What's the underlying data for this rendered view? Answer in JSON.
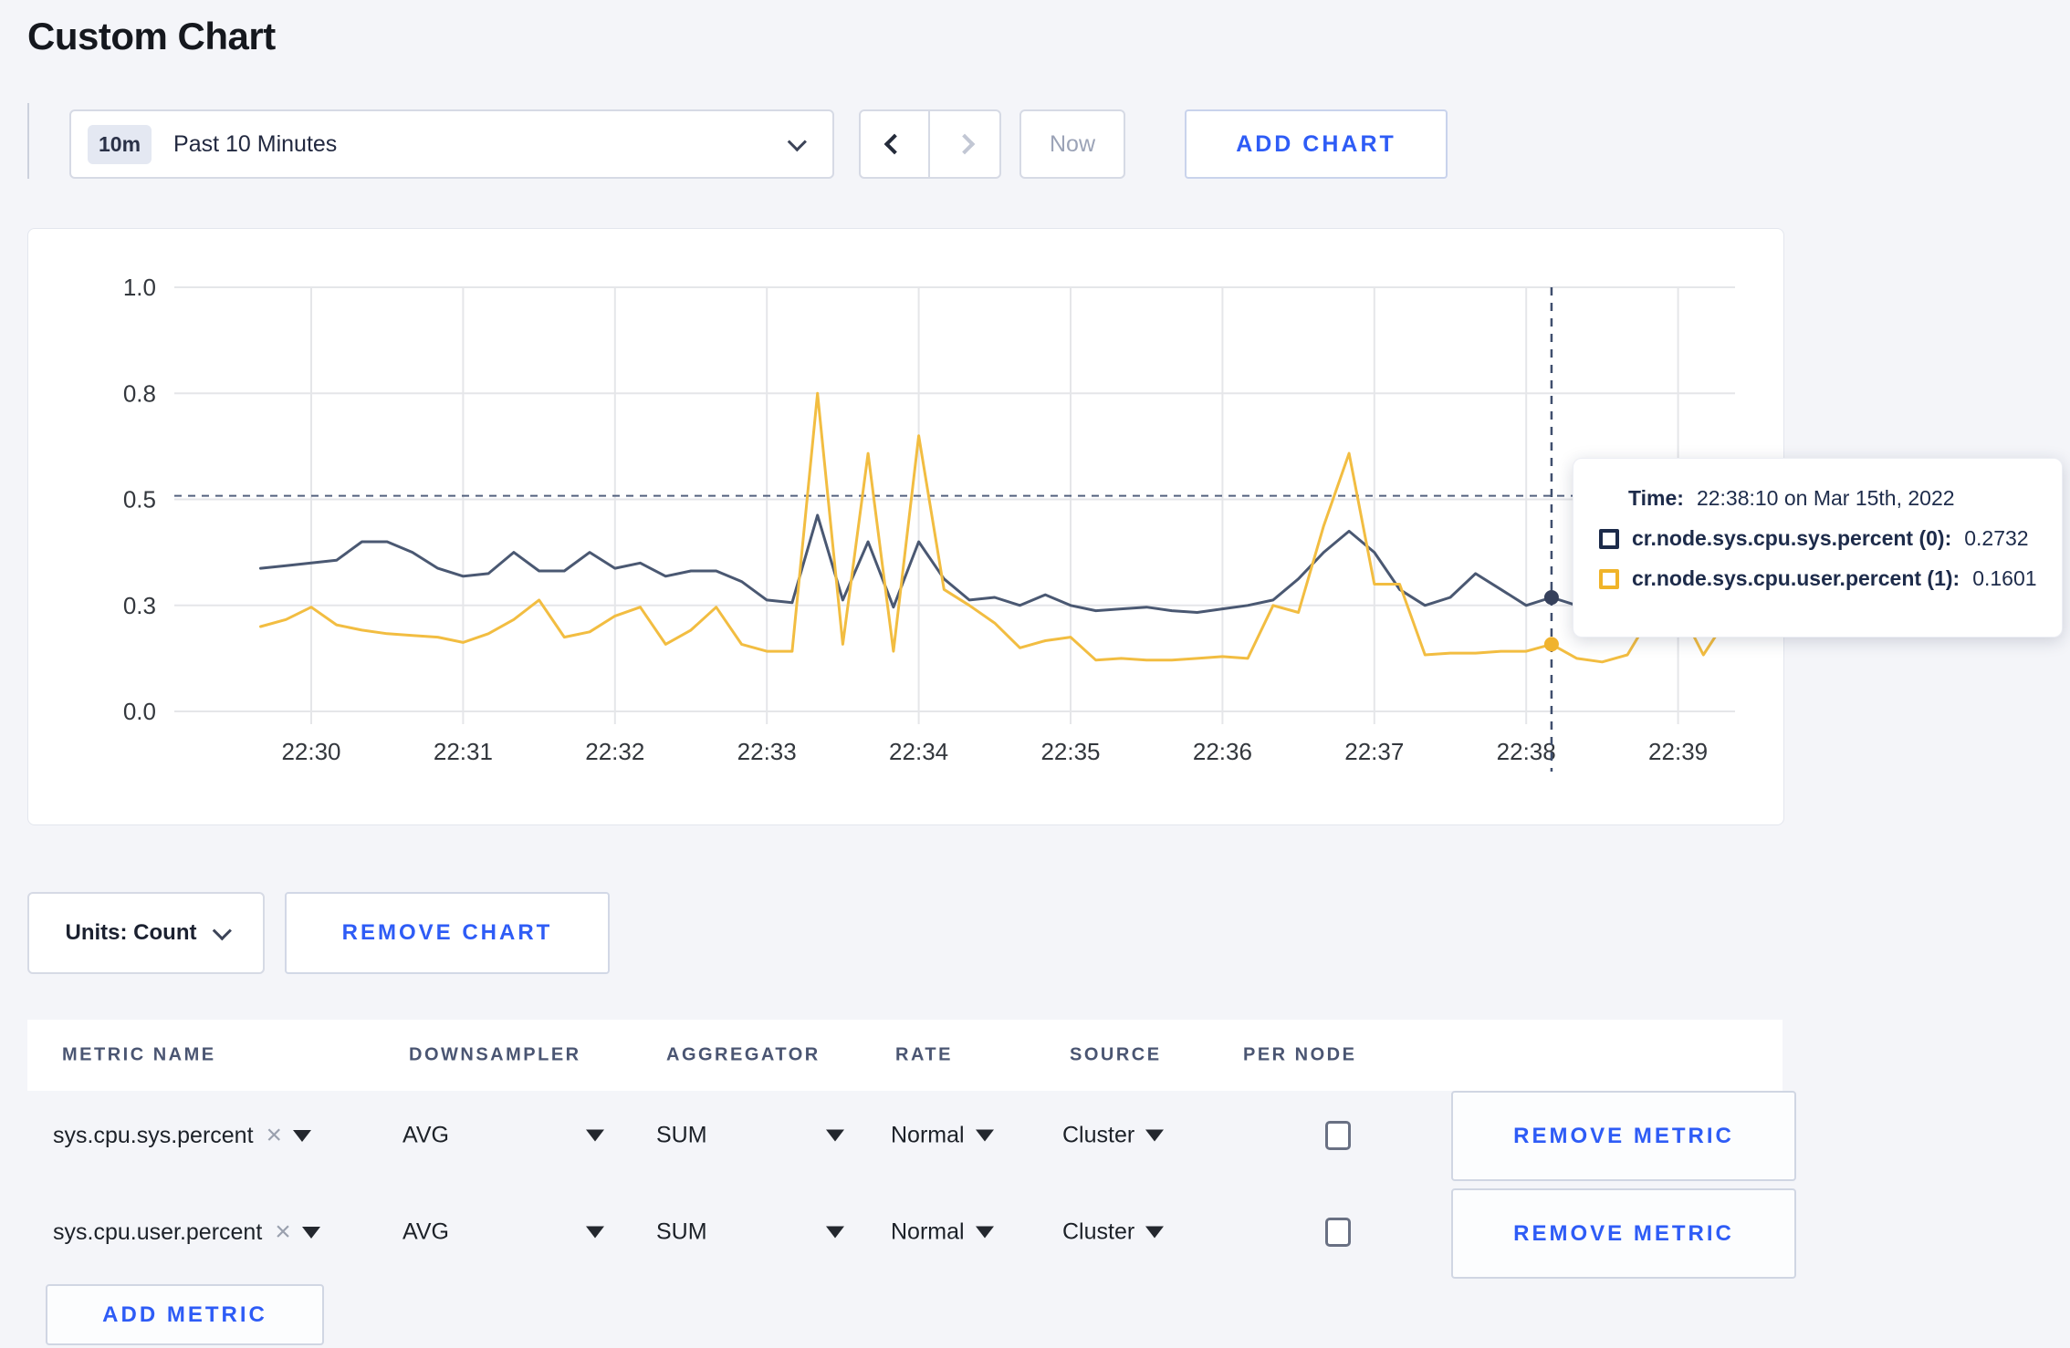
{
  "page": {
    "title": "Custom Chart"
  },
  "toolbar": {
    "time_selector": {
      "badge": "10m",
      "label": "Past 10 Minutes"
    },
    "now_button": "Now",
    "add_chart_button": "ADD CHART"
  },
  "chart": {
    "tooltip": {
      "time_label": "Time:",
      "time_value": "22:38:10 on Mar 15th, 2022",
      "series": [
        {
          "name": "cr.node.sys.cpu.sys.percent (0):",
          "value": "0.2732",
          "swatch_color": "#1c2b4a"
        },
        {
          "name": "cr.node.sys.cpu.user.percent (1):",
          "value": "0.1601",
          "swatch_color": "#f0b429"
        }
      ]
    }
  },
  "chart_data": {
    "type": "line",
    "title": "",
    "xlabel": "",
    "ylabel": "",
    "x_start_time": "22:29:40",
    "x_step_seconds": 10,
    "x_tick_labels": [
      "22:30",
      "22:31",
      "22:32",
      "22:33",
      "22:34",
      "22:35",
      "22:36",
      "22:37",
      "22:38",
      "22:39"
    ],
    "y_tick_values": [
      0.0,
      0.3,
      0.5,
      0.8,
      1.0
    ],
    "y_tick_labels": [
      "0.0",
      "0.3",
      "0.5",
      "0.8",
      "1.0"
    ],
    "grid": true,
    "legend_position": "none",
    "series": [
      {
        "name": "cr.node.sys.cpu.sys.percent (0)",
        "color": "#4a5872",
        "dot_color": "#36415c",
        "values": [
          0.37,
          0.375,
          0.38,
          0.385,
          0.42,
          0.42,
          0.4,
          0.37,
          0.355,
          0.36,
          0.4,
          0.365,
          0.365,
          0.4,
          0.37,
          0.38,
          0.355,
          0.365,
          0.365,
          0.345,
          0.31,
          0.305,
          0.47,
          0.31,
          0.42,
          0.295,
          0.42,
          0.35,
          0.31,
          0.315,
          0.3,
          0.32,
          0.3,
          0.285,
          0.29,
          0.295,
          0.285,
          0.28,
          0.29,
          0.3,
          0.31,
          0.35,
          0.4,
          0.44,
          0.4,
          0.33,
          0.3,
          0.315,
          0.36,
          0.33,
          0.3,
          0.315,
          0.3,
          0.295,
          0.305,
          0.31,
          0.295,
          0.3,
          0.305
        ]
      },
      {
        "name": "cr.node.sys.cpu.user.percent (1)",
        "color": "#f2bd41",
        "dot_color": "#f0b32e",
        "values": [
          0.24,
          0.26,
          0.295,
          0.245,
          0.23,
          0.22,
          0.215,
          0.21,
          0.195,
          0.22,
          0.26,
          0.31,
          0.21,
          0.225,
          0.27,
          0.295,
          0.19,
          0.23,
          0.295,
          0.19,
          0.17,
          0.17,
          0.8,
          0.19,
          0.63,
          0.17,
          0.68,
          0.33,
          0.3,
          0.25,
          0.18,
          0.2,
          0.21,
          0.145,
          0.15,
          0.145,
          0.145,
          0.15,
          0.155,
          0.15,
          0.3,
          0.28,
          0.45,
          0.63,
          0.34,
          0.34,
          0.16,
          0.165,
          0.165,
          0.17,
          0.17,
          0.19,
          0.15,
          0.14,
          0.16,
          0.28,
          0.3,
          0.16,
          0.27
        ]
      }
    ],
    "crosshair": {
      "point_index": 51,
      "time": "22:38:10",
      "hline_value": 0.51,
      "marked_values": [
        0.2732,
        0.1601
      ]
    }
  },
  "controls": {
    "units_button": "Units: Count",
    "remove_chart_button": "REMOVE CHART"
  },
  "metrics_table": {
    "columns": [
      "METRIC NAME",
      "DOWNSAMPLER",
      "AGGREGATOR",
      "RATE",
      "SOURCE",
      "PER NODE"
    ],
    "rows": [
      {
        "metric": "sys.cpu.sys.percent",
        "remove_x": "×",
        "downsampler": "AVG",
        "aggregator": "SUM",
        "rate": "Normal",
        "source": "Cluster",
        "per_node_checked": false,
        "remove_button": "REMOVE METRIC"
      },
      {
        "metric": "sys.cpu.user.percent",
        "remove_x": "×",
        "downsampler": "AVG",
        "aggregator": "SUM",
        "rate": "Normal",
        "source": "Cluster",
        "per_node_checked": false,
        "remove_button": "REMOVE METRIC"
      }
    ],
    "add_metric_button": "ADD METRIC"
  }
}
